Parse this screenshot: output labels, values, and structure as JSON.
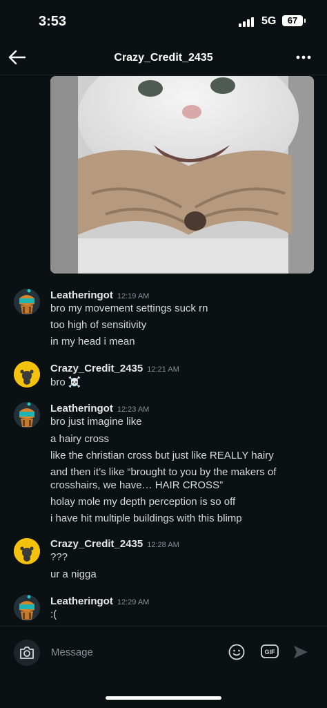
{
  "status": {
    "time": "3:53",
    "network": "5G",
    "battery": "67"
  },
  "header": {
    "title": "Crazy_Credit_2435"
  },
  "messages": [
    {
      "user": "Leatheringot",
      "time": "12:19 AM",
      "lines": [
        "bro my movement settings suck rn",
        "too high of sensitivity",
        "in my head i mean"
      ]
    },
    {
      "user": "Crazy_Credit_2435",
      "time": "12:21 AM",
      "lines": [
        "bro ☠️"
      ]
    },
    {
      "user": "Leatheringot",
      "time": "12:23 AM",
      "lines": [
        "bro just imagine like",
        "a hairy cross",
        "like the christian cross but just like REALLY hairy",
        "and then it’s like “brought to you by the makers of",
        "crosshairs, we have… HAIR CROSS”",
        "holay mole my depth perception is so off",
        "i have hit multiple buildings with this blimp"
      ]
    },
    {
      "user": "Crazy_Credit_2435",
      "time": "12:28 AM",
      "lines": [
        "???",
        "ur a nigga"
      ]
    },
    {
      "user": "Leatheringot",
      "time": "12:29 AM",
      "lines": [
        ":("
      ]
    }
  ],
  "composer": {
    "placeholder": "Message",
    "gif_label": "GIF"
  },
  "icons": [
    "back-arrow-icon",
    "more-options-icon",
    "camera-icon",
    "emoji-icon",
    "gif-icon",
    "send-icon",
    "cellular-signal-icon",
    "battery-icon"
  ],
  "colors": {
    "background": "#0b1013",
    "text": "#d7dadc",
    "muted": "#8a9096",
    "avatar_crazy": "#f4c20d"
  }
}
